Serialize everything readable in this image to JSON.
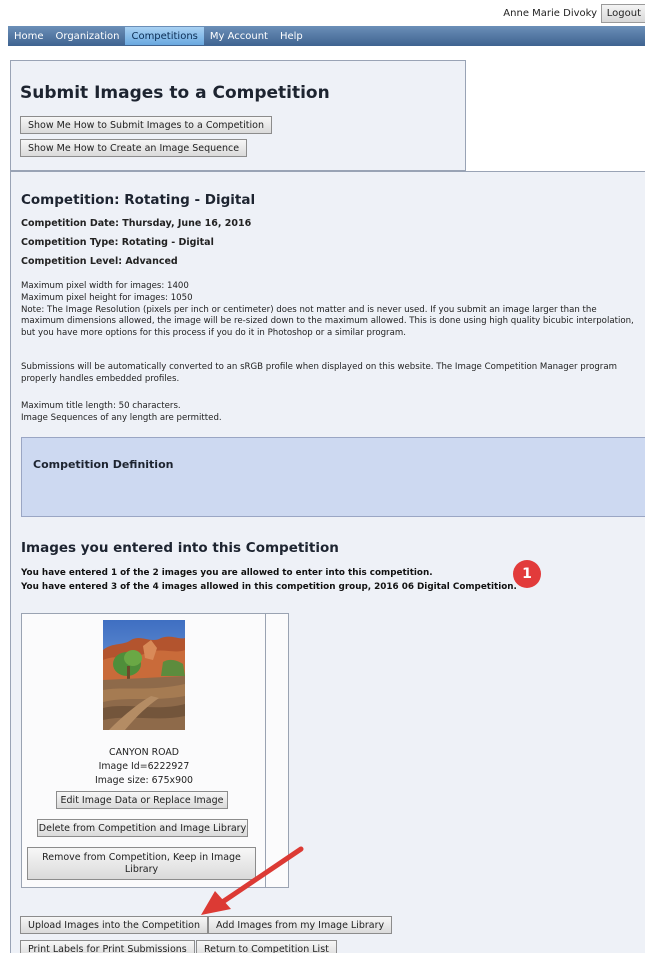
{
  "header": {
    "user_name": "Anne Marie Divoky",
    "logout_label": "Logout"
  },
  "nav": {
    "items": [
      {
        "label": "Home",
        "active": false
      },
      {
        "label": "Organization",
        "active": false
      },
      {
        "label": "Competitions",
        "active": true
      },
      {
        "label": "My Account",
        "active": false
      },
      {
        "label": "Help",
        "active": false
      }
    ]
  },
  "submit": {
    "title": "Submit Images to a Competition",
    "how_submit_label": "Show Me How to Submit Images to a Competition",
    "how_sequence_label": "Show Me How to Create an Image Sequence"
  },
  "competition": {
    "title": "Competition: Rotating - Digital",
    "date": "Competition Date: Thursday, June 16, 2016",
    "type": "Competition Type: Rotating - Digital",
    "level": "Competition Level: Advanced",
    "limits": [
      "Maximum pixel width for images: 1400",
      "Maximum pixel height for images: 1050",
      "Note: The Image Resolution (pixels per inch or centimeter) does not matter and is never used. If you submit an image larger than the",
      "maximum dimensions allowed, the image will be re-sized down to the maximum allowed. This is done using high quality bicubic interpolation,",
      "but you have more options for this process if you do it in Photoshop or a similar program."
    ],
    "srgb": [
      "Submissions will be automatically converted to an sRGB profile when displayed on this website. The Image Competition Manager program",
      "properly handles embedded profiles."
    ],
    "title_length": [
      "Maximum title length: 50 characters.",
      "Image Sequences of any length are permitted."
    ],
    "definition_title": "Competition Definition"
  },
  "entries": {
    "title": "Images you entered into this Competition",
    "message_1": "You have entered 1 of the 2 images you are allowed to enter into this competition.",
    "message_2": "You have entered 3 of the 4 images allowed in this competition group, 2016 06 Digital Competition.",
    "marker": "1",
    "image": {
      "name": "CANYON ROAD",
      "id_text": "Image Id=6222927",
      "size_text": "Image size: 675x900",
      "edit_label": "Edit Image Data or Replace Image",
      "delete_label": "Delete from Competition and Image Library",
      "remove_label": "Remove from Competition, Keep in Image Library"
    }
  },
  "actions": {
    "upload_label": "Upload Images into the Competition",
    "add_library_label": "Add Images from my Image Library",
    "print_label": "Print Labels for Print Submissions",
    "return_label": "Return to Competition List"
  },
  "colors": {
    "nav": "#4f74a3",
    "nav_active": "#8cc0ec",
    "panel": "#eef1f7",
    "definition": "#cdd9f1",
    "marker": "#e23b3b",
    "arrow": "#dc3a34"
  }
}
